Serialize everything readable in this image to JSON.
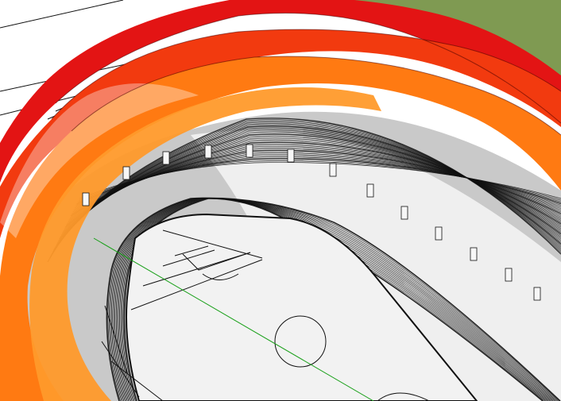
{
  "viewport": {
    "kind": "3d-model-view",
    "subject": "stadium-with-colored-roof-ribbons"
  },
  "colors": {
    "grass": "#7f9a52",
    "ground": "#ffffff",
    "roof_red": "#e31414",
    "roof_redorange": "#f23a0f",
    "roof_orange": "#ff7a12",
    "roof_lightorange": "#ff9a2b",
    "shadow": "#c9c9c9",
    "field_light": "#f2f2f2",
    "line": "#111111",
    "axis_green": "#19a019"
  },
  "icons": {
    "field": "football-field",
    "track": "running-track",
    "stands": "stadium-stands",
    "roof": "roof-ribbons"
  }
}
